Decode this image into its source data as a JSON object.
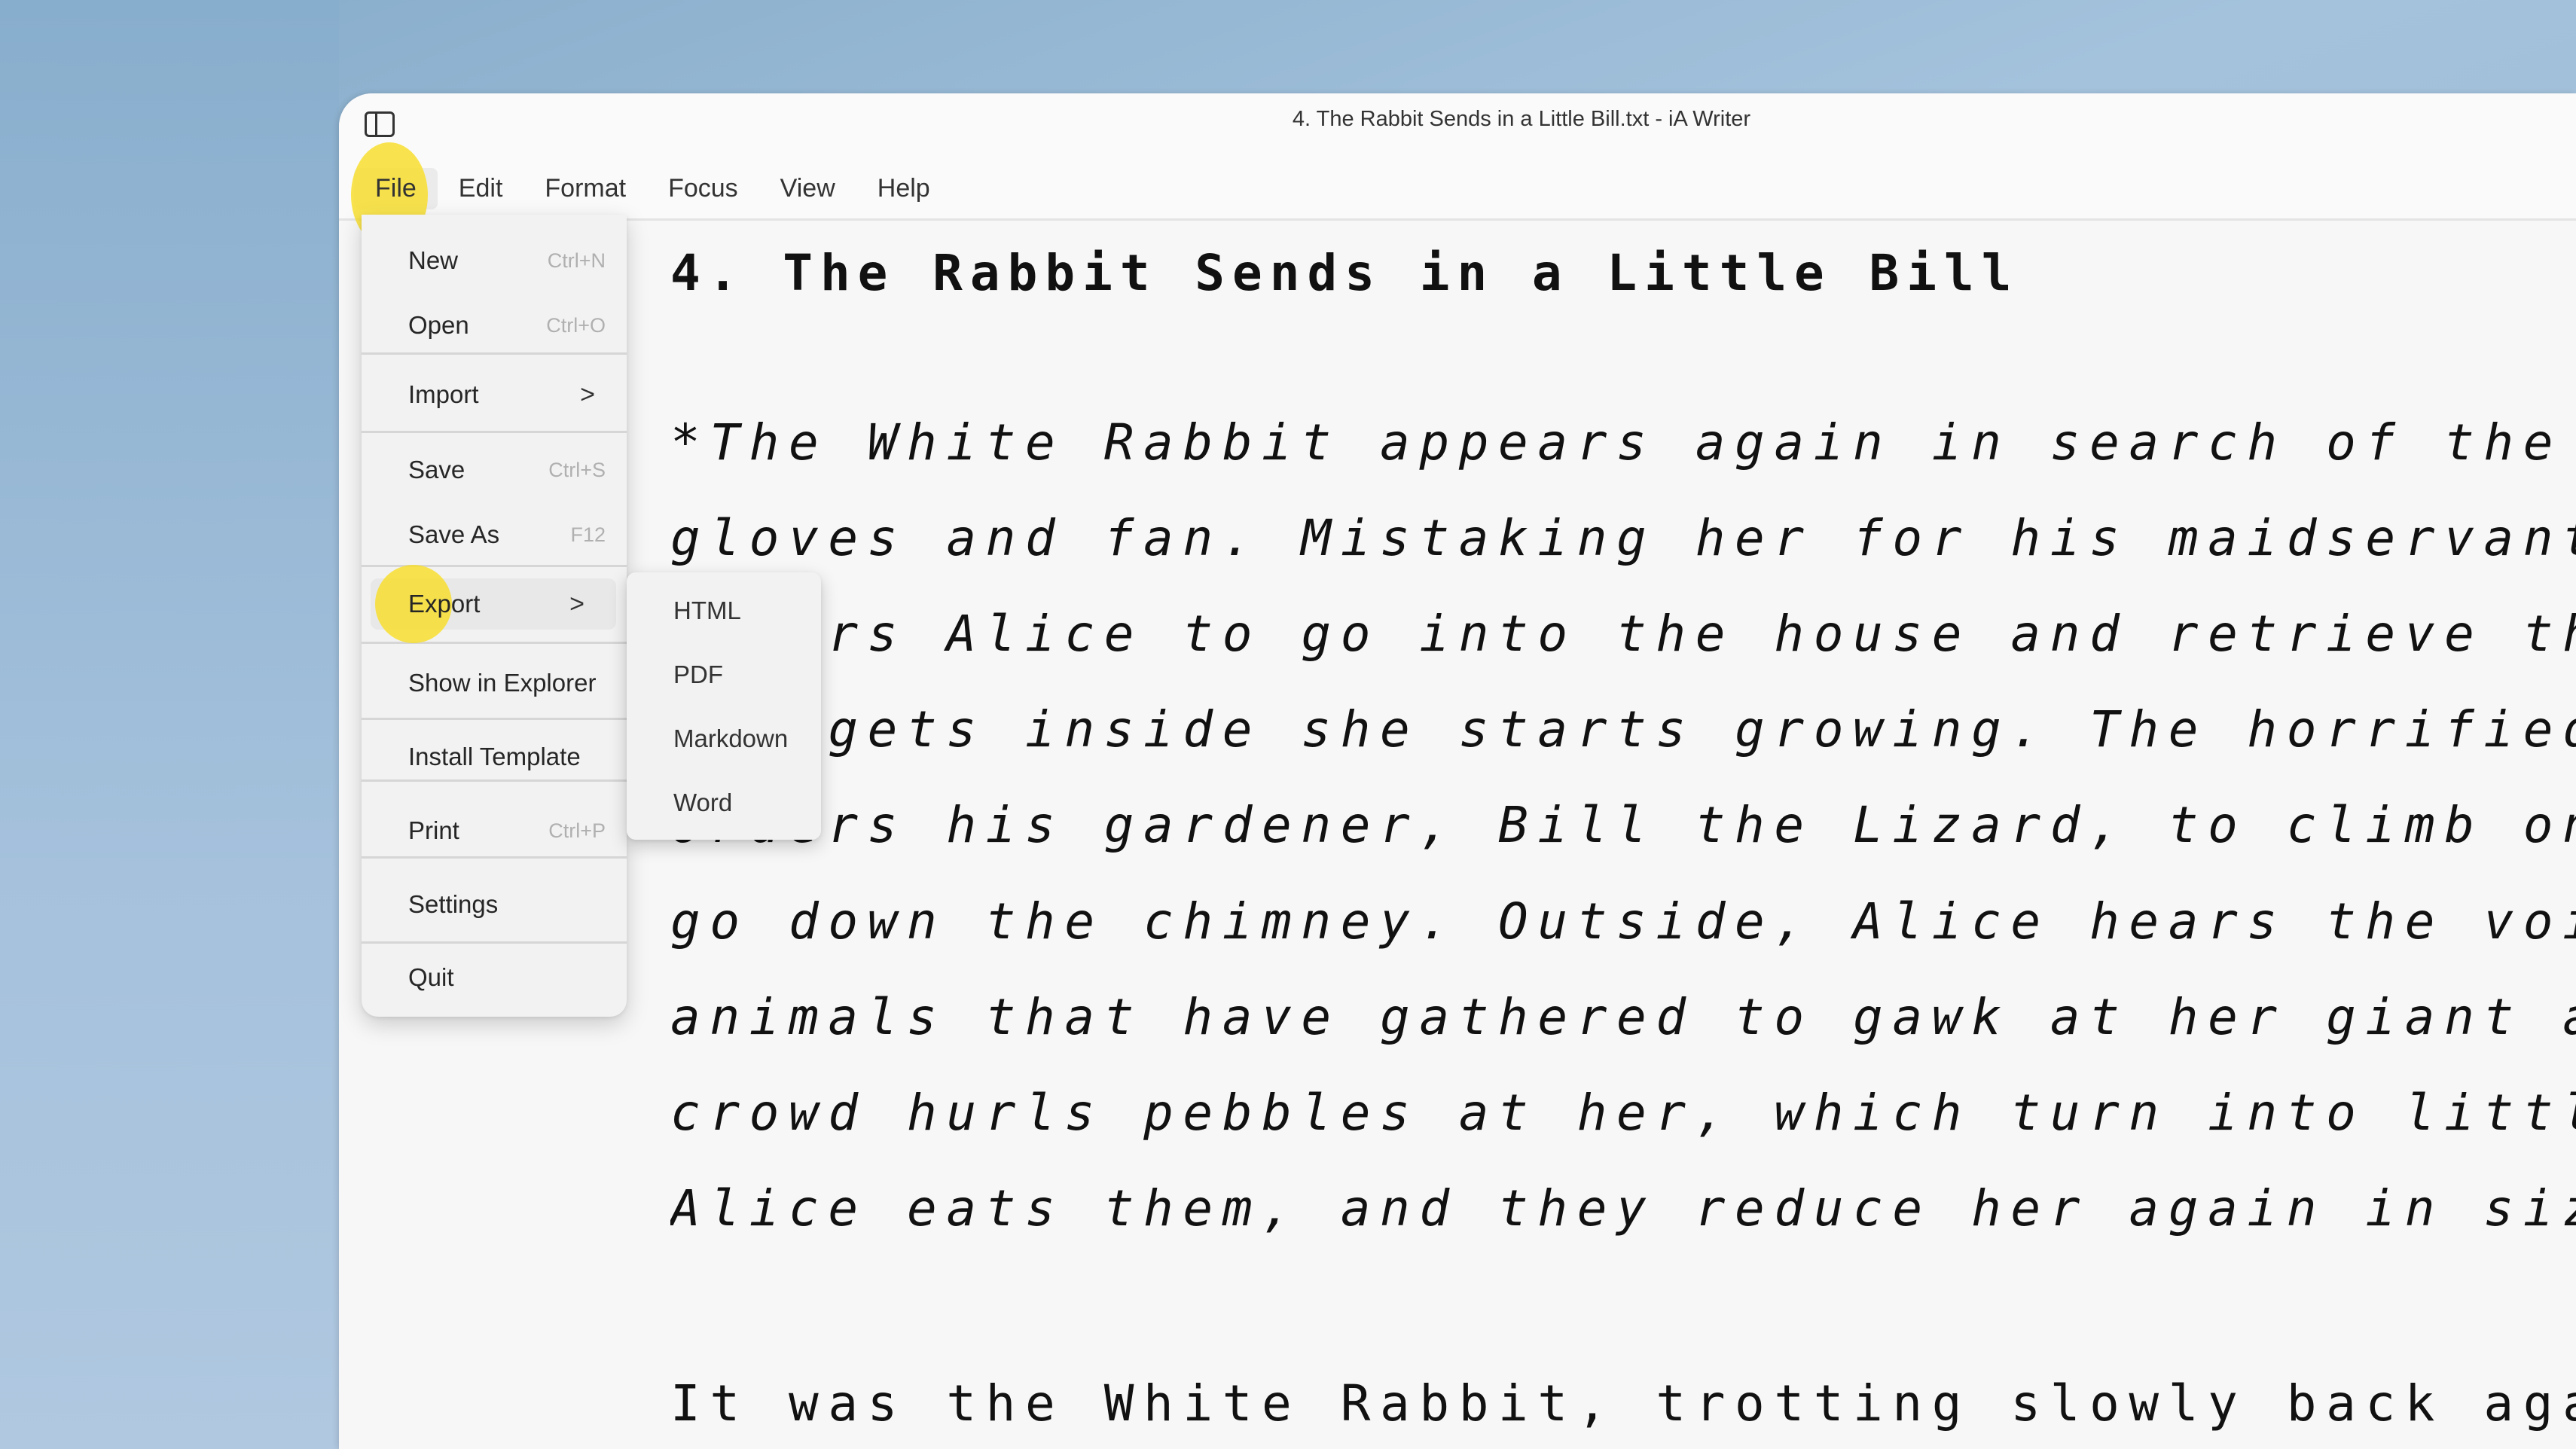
{
  "window": {
    "title": "4. The Rabbit Sends in a Little Bill.txt - iA Writer",
    "sidebar_toggle_icon": "sidebar-panel-icon"
  },
  "menubar": {
    "items": [
      "File",
      "Edit",
      "Format",
      "Focus",
      "View",
      "Help"
    ],
    "active": "File"
  },
  "file_menu": {
    "new": {
      "label": "New",
      "shortcut": "Ctrl+N"
    },
    "open": {
      "label": "Open",
      "shortcut": "Ctrl+O"
    },
    "import": {
      "label": "Import",
      "submenu_icon": ">"
    },
    "save": {
      "label": "Save",
      "shortcut": "Ctrl+S"
    },
    "save_as": {
      "label": "Save As",
      "shortcut": "F12"
    },
    "export": {
      "label": "Export",
      "submenu_icon": ">"
    },
    "show_in_explorer": {
      "label": "Show in Explorer"
    },
    "install_template": {
      "label": "Install Template"
    },
    "print": {
      "label": "Print",
      "shortcut": "Ctrl+P"
    },
    "settings": {
      "label": "Settings"
    },
    "quit": {
      "label": "Quit"
    }
  },
  "export_submenu": {
    "items": [
      "HTML",
      "PDF",
      "Markdown",
      "Word"
    ]
  },
  "editor": {
    "heading_marker": "#",
    "heading": "4. The Rabbit Sends in a Little Bill",
    "summary_lines": [
      "*The White Rabbit appears again in search of the Duchess's",
      "gloves and fan. Mistaking her for his maidservant, Mary Ann, he",
      "orders Alice to go into the house and retrieve them, but once",
      "she gets inside she starts growing. The horrified Rabbit",
      "orders his gardener, Bill the Lizard, to climb on the roof and",
      "go down the chimney. Outside, Alice hears the voices of",
      "animals that have gathered to gawk at her giant arm. The",
      "crowd hurls pebbles at her, which turn into little cakes.",
      "Alice eats them, and they reduce her again in size.*"
    ],
    "body_line": "It was the White Rabbit, trotting slowly back again, and"
  },
  "colors": {
    "highlight": "#f8de28",
    "menu_bg": "#f2f2f2",
    "editor_bg": "#f7f7f7",
    "shortcut_text": "#b0b0b0"
  }
}
